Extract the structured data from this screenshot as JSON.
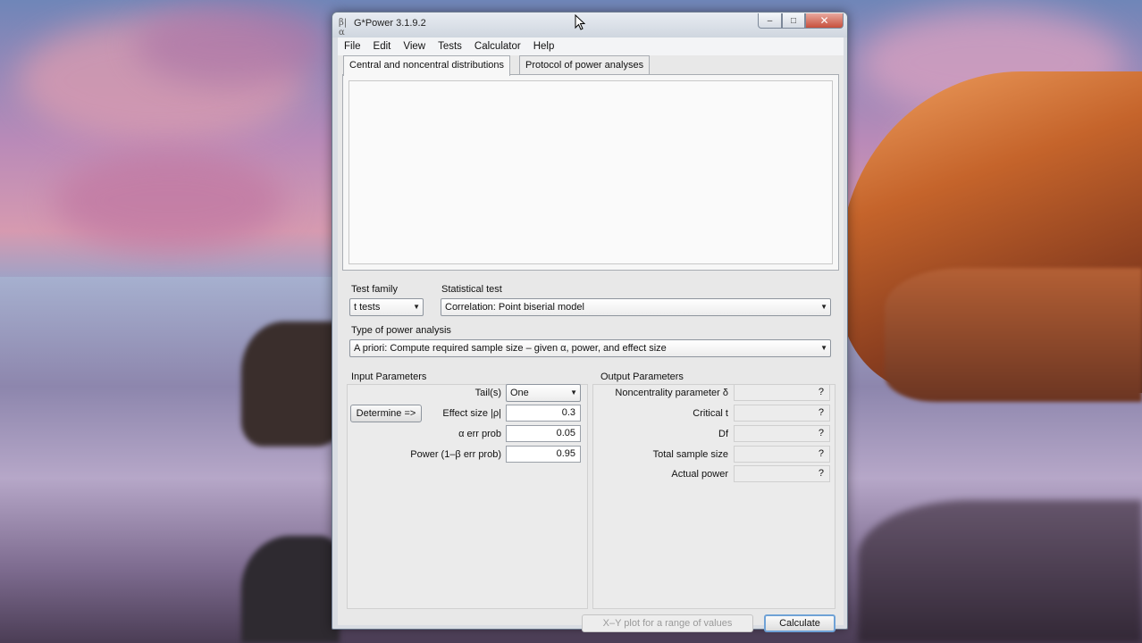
{
  "window": {
    "title": "G*Power 3.1.9.2",
    "app_icon": "β|α",
    "minimize_glyph": "–",
    "maximize_glyph": "□",
    "close_glyph": "✕"
  },
  "menu": [
    "File",
    "Edit",
    "View",
    "Tests",
    "Calculator",
    "Help"
  ],
  "tabs": [
    {
      "label": "Central and noncentral distributions",
      "active": true
    },
    {
      "label": "Protocol of power analyses",
      "active": false
    }
  ],
  "test_family": {
    "label": "Test family",
    "value": "t tests"
  },
  "statistical_test": {
    "label": "Statistical test",
    "value": "Correlation: Point biserial model"
  },
  "power_analysis": {
    "label": "Type of power analysis",
    "value": "A priori: Compute required sample size – given α, power, and effect size"
  },
  "input": {
    "title": "Input Parameters",
    "tails_label": "Tail(s)",
    "tails_value": "One",
    "determine_label": "Determine =>",
    "effect_label": "Effect size |ρ|",
    "effect_value": "0.3",
    "alpha_label": "α err prob",
    "alpha_value": "0.05",
    "power_label": "Power (1–β err prob)",
    "power_value": "0.95"
  },
  "output": {
    "title": "Output Parameters",
    "rows": [
      {
        "label": "Noncentrality parameter δ",
        "value": "?"
      },
      {
        "label": "Critical t",
        "value": "?"
      },
      {
        "label": "Df",
        "value": "?"
      },
      {
        "label": "Total sample size",
        "value": "?"
      },
      {
        "label": "Actual power",
        "value": "?"
      }
    ]
  },
  "buttons": {
    "xy_plot": "X–Y plot for a range of values",
    "calculate": "Calculate"
  },
  "combo_arrow": "▼"
}
